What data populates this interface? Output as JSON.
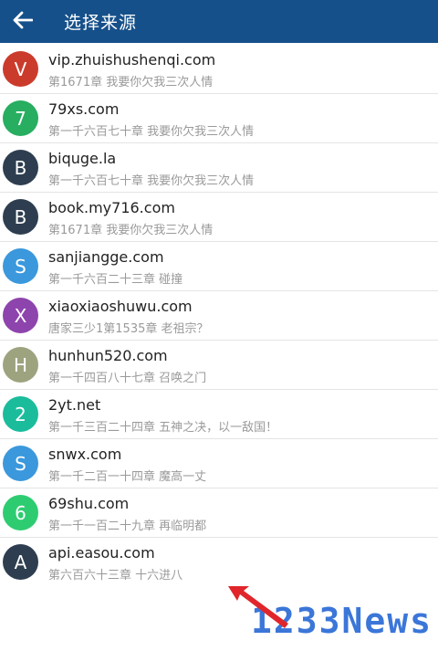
{
  "header": {
    "title": "选择来源"
  },
  "icons": {
    "back": "arrow-left-icon"
  },
  "sources": [
    {
      "letter": "V",
      "color": "#cb3b2c",
      "name": "vip.zhuishushenqi.com",
      "chapter": "第1671章 我要你欠我三次人情"
    },
    {
      "letter": "7",
      "color": "#27ae60",
      "name": "79xs.com",
      "chapter": "第一千六百七十章 我要你欠我三次人情"
    },
    {
      "letter": "B",
      "color": "#2e3e50",
      "name": "biquge.la",
      "chapter": "第一千六百七十章 我要你欠我三次人情"
    },
    {
      "letter": "B",
      "color": "#2e3e50",
      "name": "book.my716.com",
      "chapter": "第1671章 我要你欠我三次人情"
    },
    {
      "letter": "S",
      "color": "#3b98dc",
      "name": "sanjiangge.com",
      "chapter": "第一千六百二十三章 碰撞"
    },
    {
      "letter": "X",
      "color": "#8e44ad",
      "name": "xiaoxiaoshuwu.com",
      "chapter": "唐家三少1第1535章 老祖宗？"
    },
    {
      "letter": "H",
      "color": "#9ea37f",
      "name": "hunhun520.com",
      "chapter": "第一千四百八十七章 召唤之门"
    },
    {
      "letter": "2",
      "color": "#1abc9c",
      "name": "2yt.net",
      "chapter": "第一千三百二十四章 五神之决，以一敌国！"
    },
    {
      "letter": "S",
      "color": "#3b98dc",
      "name": "snwx.com",
      "chapter": "第一千二百一十四章 魔高一丈"
    },
    {
      "letter": "6",
      "color": "#2ecc71",
      "name": "69shu.com",
      "chapter": "第一千一百二十九章 再临明都"
    },
    {
      "letter": "A",
      "color": "#2e3e50",
      "name": "api.easou.com",
      "chapter": "第六百六十三章 十六进八"
    }
  ],
  "watermark": {
    "text": "1233News"
  }
}
